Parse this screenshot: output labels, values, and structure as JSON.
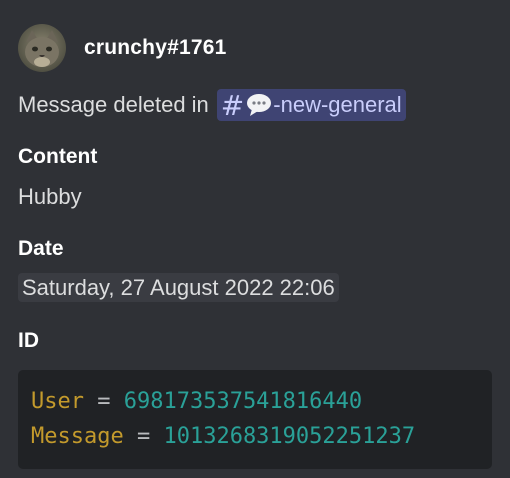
{
  "embed": {
    "author": {
      "name": "crunchy#1761"
    },
    "description": {
      "text": "Message deleted in",
      "channel": {
        "hash": "#",
        "name": "-new-general"
      }
    },
    "fields": [
      {
        "name": "Content",
        "value": "Hubby"
      },
      {
        "name": "Date",
        "value": "Saturday, 27 August 2022 22:06"
      },
      {
        "name": "ID"
      }
    ],
    "code": {
      "user_key": "User",
      "user_eq": "=",
      "user_value": "698173537541816440",
      "message_key": "Message",
      "message_eq": "=",
      "message_value": "1013268319052251237"
    }
  },
  "colors": {
    "background": "#2f3136",
    "code_background": "#202225",
    "mention_background": "#3f4473",
    "mention_text": "#c9cdfb",
    "key": "#c39a2c",
    "number": "#2aa198"
  },
  "icons": {
    "avatar": "cat-avatar",
    "channel_emoji": "speech-balloon-icon"
  }
}
